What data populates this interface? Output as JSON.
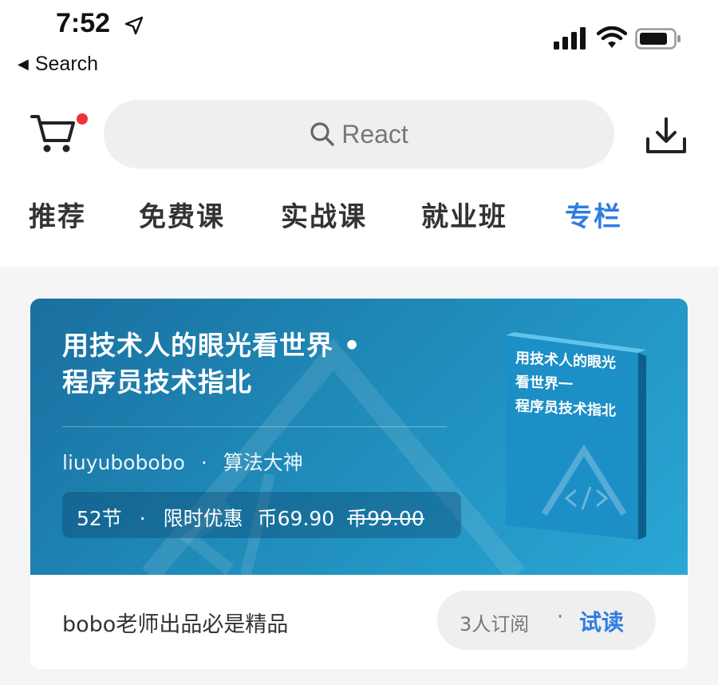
{
  "status_bar": {
    "time": "7:52",
    "back_label": "Search",
    "icons": [
      "location-arrow-icon",
      "cellular-signal-icon",
      "wifi-icon",
      "battery-icon"
    ]
  },
  "top_bar": {
    "cart_icon": "shopping-cart-icon",
    "cart_badge_color": "#f2323b",
    "search_placeholder": "React",
    "search_icon": "search-icon",
    "download_icon": "download-icon"
  },
  "tabs": [
    {
      "label": "推荐",
      "active": false
    },
    {
      "label": "免费课",
      "active": false
    },
    {
      "label": "实战课",
      "active": false
    },
    {
      "label": "就业班",
      "active": false
    },
    {
      "label": "专栏",
      "active": true
    }
  ],
  "colors": {
    "accent": "#2f7de3",
    "banner_blue": "#1f8ab8",
    "background": "#f5f5f7"
  },
  "card": {
    "banner_title_line1": "用技术人的眼光看世界 •",
    "banner_title_line2": "程序员技术指北",
    "author": "liuyubobobo",
    "author_sep": "·",
    "author_title": "算法大神",
    "lessons": "52节",
    "promo_sep": "·",
    "promo_label": "限时优惠",
    "price_current": "币69.90",
    "price_original": "币99.00",
    "book_cover_line1": "用技术人的眼光",
    "book_cover_line2": "看世界一",
    "book_cover_line3": "程序员技术指北",
    "slogan": "bobo老师出品必是精品",
    "subscribers": "3人订阅",
    "action_sep": "·",
    "try_read": "试读"
  }
}
